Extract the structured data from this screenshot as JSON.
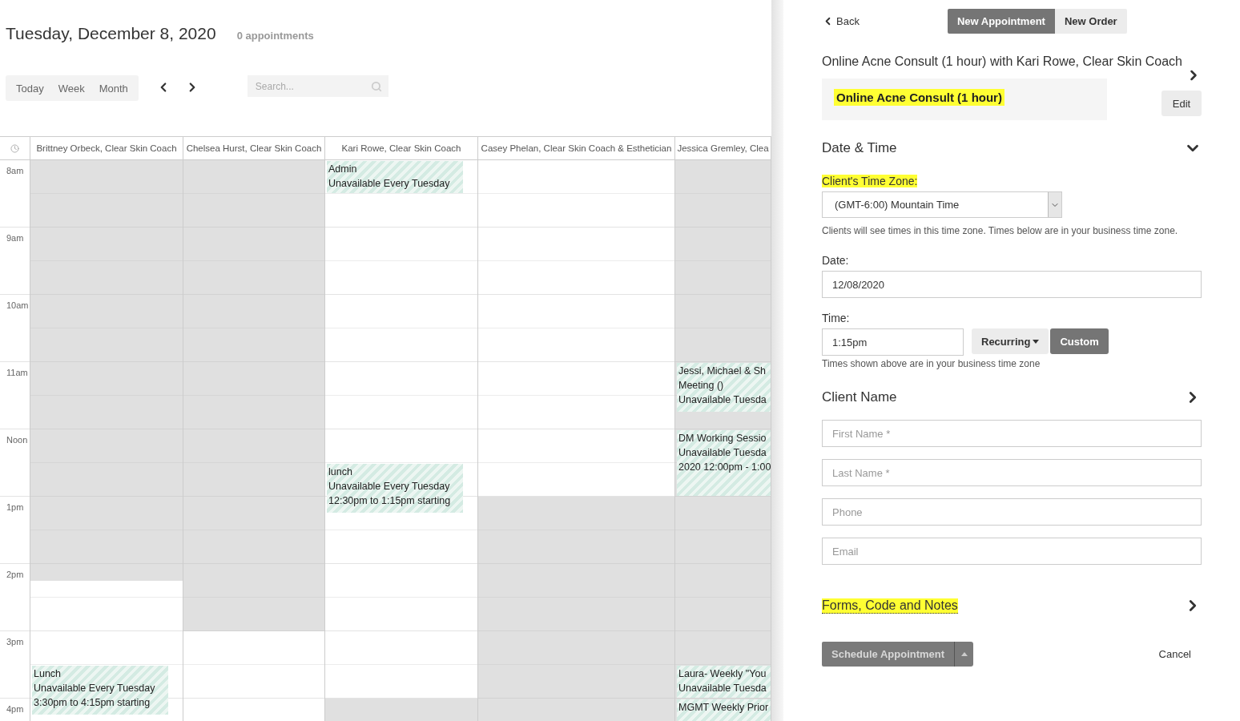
{
  "calendar": {
    "title": "Tuesday, December 8, 2020",
    "count": "0 appointments",
    "views": [
      "Today",
      "Week",
      "Month"
    ],
    "search": {
      "placeholder": "Search..."
    },
    "hours": [
      "8am",
      "9am",
      "10am",
      "11am",
      "Noon",
      "1pm",
      "2pm",
      "3pm",
      "4pm"
    ],
    "columns": [
      {
        "name": "Brittney Orbeck, Clear Skin Coach",
        "slots": [
          {
            "kind": "unavailable"
          },
          {
            "kind": "unavailable"
          },
          {
            "kind": "unavailable"
          },
          {
            "kind": "unavailable"
          },
          {
            "kind": "unavailable"
          },
          {
            "kind": "unavailable"
          },
          {
            "kind": "unavailable"
          },
          {
            "kind": "unavailable"
          },
          {
            "kind": "unavailable"
          },
          {
            "kind": "unavailable"
          },
          {
            "kind": "unavailable"
          },
          {
            "kind": "unavailable"
          },
          {
            "kind": "unavailable"
          },
          {
            "kind": "unavailable"
          },
          {
            "kind": "unavailable"
          },
          {
            "kind": "unavailable"
          },
          {
            "kind": "unavailable"
          },
          {
            "kind": "unavailable"
          },
          {
            "kind": "unavailable"
          },
          {
            "kind": "unavailable"
          },
          {
            "kind": "unavailable"
          },
          {
            "kind": "unavailable"
          },
          {
            "kind": "unavailable"
          },
          {
            "kind": "unavailable"
          },
          {
            "kind": "unavailable"
          },
          {
            "kind": "open"
          },
          {
            "kind": "open"
          },
          {
            "kind": "open"
          },
          {
            "kind": "open"
          },
          {
            "kind": "open"
          },
          {
            "kind": "event",
            "lines": [
              "Lunch",
              "Unavailable Every Tuesday",
              "3:30pm to 4:15pm starting"
            ]
          },
          {
            "kind": "continued"
          },
          {
            "kind": "continued"
          }
        ]
      },
      {
        "name": "Chelsea Hurst, Clear Skin Coach",
        "slots": [
          {
            "kind": "unavailable"
          },
          {
            "kind": "unavailable"
          },
          {
            "kind": "unavailable"
          },
          {
            "kind": "unavailable"
          },
          {
            "kind": "unavailable"
          },
          {
            "kind": "unavailable"
          },
          {
            "kind": "unavailable"
          },
          {
            "kind": "unavailable"
          },
          {
            "kind": "unavailable"
          },
          {
            "kind": "unavailable"
          },
          {
            "kind": "unavailable"
          },
          {
            "kind": "unavailable"
          },
          {
            "kind": "unavailable"
          },
          {
            "kind": "unavailable"
          },
          {
            "kind": "unavailable"
          },
          {
            "kind": "unavailable"
          },
          {
            "kind": "unavailable"
          },
          {
            "kind": "unavailable"
          },
          {
            "kind": "unavailable"
          },
          {
            "kind": "unavailable"
          },
          {
            "kind": "unavailable"
          },
          {
            "kind": "unavailable"
          },
          {
            "kind": "unavailable"
          },
          {
            "kind": "unavailable"
          },
          {
            "kind": "unavailable"
          },
          {
            "kind": "unavailable"
          },
          {
            "kind": "unavailable"
          },
          {
            "kind": "unavailable"
          },
          {
            "kind": "open"
          },
          {
            "kind": "open"
          },
          {
            "kind": "open"
          },
          {
            "kind": "open"
          },
          {
            "kind": "open"
          },
          {
            "kind": "open"
          }
        ]
      },
      {
        "name": "Kari Rowe, Clear Skin Coach",
        "slots": [
          {
            "kind": "event",
            "lines": [
              "Admin",
              "Unavailable Every Tuesday"
            ]
          },
          {
            "kind": "continued"
          },
          {
            "kind": "open"
          },
          {
            "kind": "open"
          },
          {
            "kind": "open"
          },
          {
            "kind": "open"
          },
          {
            "kind": "open"
          },
          {
            "kind": "open"
          },
          {
            "kind": "open"
          },
          {
            "kind": "open"
          },
          {
            "kind": "open"
          },
          {
            "kind": "open"
          },
          {
            "kind": "open"
          },
          {
            "kind": "open"
          },
          {
            "kind": "open"
          },
          {
            "kind": "open"
          },
          {
            "kind": "open"
          },
          {
            "kind": "open"
          },
          {
            "kind": "event",
            "lines": [
              "lunch",
              "Unavailable Every Tuesday",
              "12:30pm to 1:15pm starting"
            ]
          },
          {
            "kind": "continued"
          },
          {
            "kind": "continued"
          },
          {
            "kind": "open"
          },
          {
            "kind": "open"
          },
          {
            "kind": "open"
          },
          {
            "kind": "open"
          },
          {
            "kind": "open"
          },
          {
            "kind": "open"
          },
          {
            "kind": "open"
          },
          {
            "kind": "open"
          },
          {
            "kind": "open"
          },
          {
            "kind": "open"
          },
          {
            "kind": "open"
          },
          {
            "kind": "unavailable"
          },
          {
            "kind": "unavailable"
          }
        ]
      },
      {
        "name": "Casey Phelan, Clear Skin Coach & Esthetician",
        "slots": [
          {
            "kind": "open"
          },
          {
            "kind": "open"
          },
          {
            "kind": "open"
          },
          {
            "kind": "open"
          },
          {
            "kind": "open"
          },
          {
            "kind": "open"
          },
          {
            "kind": "open"
          },
          {
            "kind": "open"
          },
          {
            "kind": "open"
          },
          {
            "kind": "open"
          },
          {
            "kind": "open"
          },
          {
            "kind": "open"
          },
          {
            "kind": "open"
          },
          {
            "kind": "open"
          },
          {
            "kind": "open"
          },
          {
            "kind": "open"
          },
          {
            "kind": "open"
          },
          {
            "kind": "open"
          },
          {
            "kind": "open"
          },
          {
            "kind": "open"
          },
          {
            "kind": "unavailable"
          },
          {
            "kind": "unavailable"
          },
          {
            "kind": "unavailable"
          },
          {
            "kind": "unavailable"
          },
          {
            "kind": "unavailable"
          },
          {
            "kind": "unavailable"
          },
          {
            "kind": "unavailable"
          },
          {
            "kind": "unavailable"
          },
          {
            "kind": "unavailable"
          },
          {
            "kind": "unavailable"
          },
          {
            "kind": "unavailable"
          },
          {
            "kind": "unavailable"
          },
          {
            "kind": "unavailable"
          },
          {
            "kind": "unavailable"
          }
        ]
      },
      {
        "name": "Jessica Gremley, Clea",
        "slots": [
          {
            "kind": "unavailable"
          },
          {
            "kind": "unavailable"
          },
          {
            "kind": "unavailable"
          },
          {
            "kind": "unavailable"
          },
          {
            "kind": "unavailable"
          },
          {
            "kind": "unavailable"
          },
          {
            "kind": "unavailable"
          },
          {
            "kind": "unavailable"
          },
          {
            "kind": "unavailable"
          },
          {
            "kind": "unavailable"
          },
          {
            "kind": "unavailable"
          },
          {
            "kind": "unavailable"
          },
          {
            "kind": "event",
            "lines": [
              "Jessi, Michael & Sh",
              "Meeting ()",
              "Unavailable Tuesda"
            ]
          },
          {
            "kind": "continued"
          },
          {
            "kind": "continued"
          },
          {
            "kind": "unavailable"
          },
          {
            "kind": "event",
            "lines": [
              "DM Working Sessio",
              "Unavailable Tuesda",
              "2020 12:00pm - 1:00"
            ]
          },
          {
            "kind": "continued"
          },
          {
            "kind": "continued"
          },
          {
            "kind": "continued"
          },
          {
            "kind": "unavailable"
          },
          {
            "kind": "unavailable"
          },
          {
            "kind": "unavailable"
          },
          {
            "kind": "unavailable"
          },
          {
            "kind": "unavailable"
          },
          {
            "kind": "unavailable"
          },
          {
            "kind": "unavailable"
          },
          {
            "kind": "unavailable"
          },
          {
            "kind": "unavailable"
          },
          {
            "kind": "unavailable"
          },
          {
            "kind": "event",
            "lines": [
              "Laura- Weekly \"You",
              "Unavailable Tuesda"
            ]
          },
          {
            "kind": "continued"
          },
          {
            "kind": "event",
            "lines": [
              "MGMT Weekly Prior"
            ]
          },
          {
            "kind": "continued"
          }
        ]
      }
    ]
  },
  "panel": {
    "back": "Back",
    "tabs": [
      {
        "label": "New Appointment",
        "selected": true
      },
      {
        "label": "New Order",
        "selected": false
      }
    ],
    "title": "Online Acne Consult (1 hour) with Kari Rowe, Clear Skin Coach",
    "service": {
      "name": "Online Acne Consult (1 hour)",
      "highlighted": true,
      "edit": "Edit"
    },
    "date_time": {
      "heading": "Date & Time",
      "expanded": true,
      "timezone_label": {
        "text": "Client's Time Zone:",
        "highlighted": true
      },
      "timezone": "(GMT-6:00) Mountain Time",
      "timezone_help": "Clients will see times in this time zone. Times below are in your business time zone.",
      "date_label": "Date:",
      "date": "12/08/2020",
      "time_label": "Time:",
      "time": "1:15pm",
      "time_modes": [
        {
          "label": "Recurring",
          "selected": false
        },
        {
          "label": "Custom",
          "selected": true
        }
      ],
      "time_help": "Times shown above are in your business time zone"
    },
    "client": {
      "heading": "Client Name",
      "fields": [
        {
          "placeholder": "First Name *"
        },
        {
          "placeholder": "Last Name *"
        },
        {
          "placeholder": "Phone"
        },
        {
          "placeholder": "Email"
        }
      ]
    },
    "forms": {
      "heading": "Forms, Code and Notes",
      "highlighted": true
    },
    "schedule": "Schedule Appointment",
    "cancel": "Cancel"
  }
}
